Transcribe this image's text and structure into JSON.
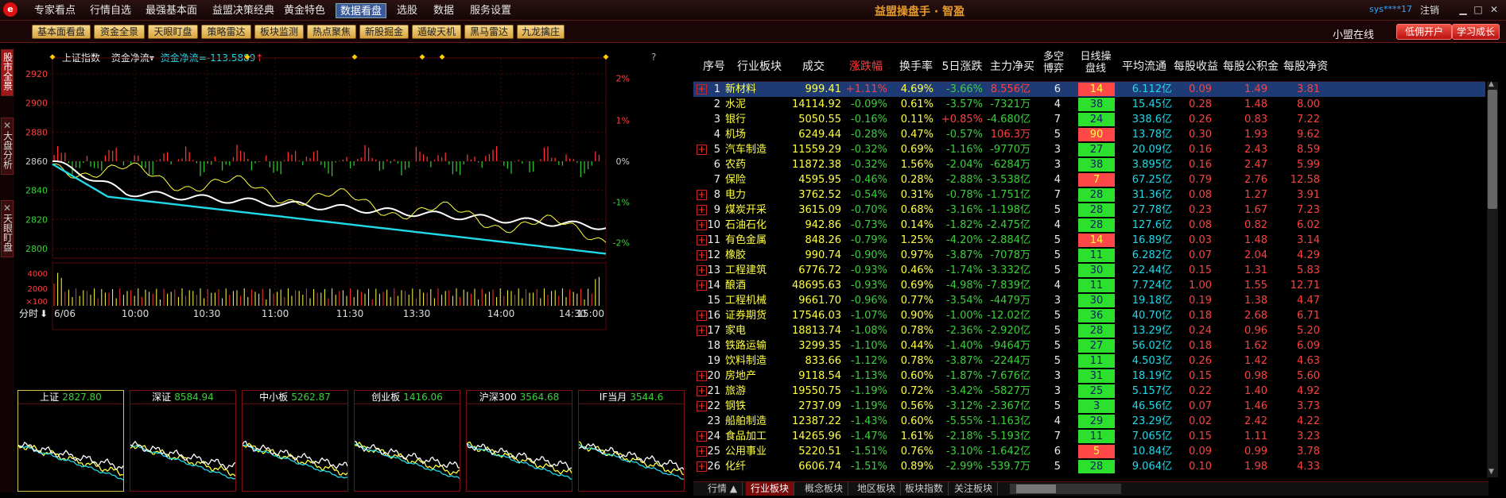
{
  "menu": {
    "logo": "e",
    "items": [
      "专家看点",
      "行情自选",
      "最强基本面",
      "益盟决策经典",
      "黄金特色",
      "数据看盘",
      "选股",
      "数据",
      "服务设置"
    ],
    "active_index": 5
  },
  "app_title": "益盟操盘手 · 智盈",
  "user": "sys****17",
  "logout": "注销",
  "toolbar": {
    "buttons": [
      "基本面看盘",
      "资金全景",
      "天眼盯盘",
      "策略雷达",
      "板块监测",
      "热点聚焦",
      "新股掘金",
      "遁破天机",
      "黑马雷达",
      "九龙擒庄"
    ],
    "online": "小盟在线",
    "open_account": "低佣开户",
    "learn": "学习成长"
  },
  "side_tabs": [
    "股市全景",
    "大盘分析",
    "天眼盯盘"
  ],
  "chart": {
    "index_name": "上证指数",
    "indicator": "资金净流",
    "indicator_value": "资金净流=-113.5889",
    "help": "?",
    "price_ticks": [
      "2920",
      "2900",
      "2880",
      "2860",
      "2840",
      "2820",
      "2800"
    ],
    "pct_ticks": [
      "2%",
      "1%",
      "0%",
      "-1%",
      "-2%"
    ],
    "vol_ticks": [
      "4000",
      "2000",
      "×100"
    ],
    "time_ticks": [
      "6/06",
      "10:00",
      "10:30",
      "11:00",
      "11:30",
      "13:30",
      "14:00",
      "14:30",
      "15:00"
    ],
    "period_label": "分时",
    "period_arrow": "⬇",
    "colors": {
      "price": "#ffffff",
      "avg": "#ffff40",
      "flow": "#20d8e8",
      "up": "#ff3030",
      "down": "#30c030"
    }
  },
  "thumbs": [
    {
      "name": "上证",
      "value": "2827.80"
    },
    {
      "name": "深证",
      "value": "8584.94"
    },
    {
      "name": "中小板",
      "value": "5262.87"
    },
    {
      "name": "创业板",
      "value": "1416.06"
    },
    {
      "name": "沪深300",
      "value": "3564.68"
    },
    {
      "name": "IF当月",
      "value": "3544.6"
    }
  ],
  "table": {
    "headers": [
      "序号",
      "行业板块",
      "成交",
      "涨跌幅",
      "换手率",
      "5日涨跌",
      "主力净买"
    ],
    "headers2": [
      [
        "多空",
        "博弈"
      ],
      [
        "日线操",
        "盘线"
      ]
    ],
    "headers3": [
      "平均流通",
      "每股收益",
      "每股公积金",
      "每股净资"
    ],
    "rows": [
      {
        "no": "1",
        "name": "新材料",
        "vol": "999.41",
        "chg": "+1.11%",
        "turn": "4.69%",
        "d5": "-3.66%",
        "net": "8.556亿",
        "ls": "6",
        "day": "14",
        "flt": "6.112亿",
        "eps": "0.09",
        "cap": "1.49",
        "nav": "3.81",
        "plus": true,
        "sel": true,
        "badge": "red"
      },
      {
        "no": "2",
        "name": "水泥",
        "vol": "14114.92",
        "chg": "-0.09%",
        "turn": "0.61%",
        "d5": "-3.57%",
        "net": "-7321万",
        "ls": "4",
        "day": "38",
        "flt": "15.45亿",
        "eps": "0.28",
        "cap": "1.48",
        "nav": "8.00",
        "plus": false,
        "badge": "green"
      },
      {
        "no": "3",
        "name": "银行",
        "vol": "5050.55",
        "chg": "-0.16%",
        "turn": "0.11%",
        "d5": "+0.85%",
        "net": "-4.680亿",
        "ls": "7",
        "day": "24",
        "flt": "338.6亿",
        "eps": "0.26",
        "cap": "0.83",
        "nav": "7.22",
        "plus": false,
        "badge": "green"
      },
      {
        "no": "4",
        "name": "机场",
        "vol": "6249.44",
        "chg": "-0.28%",
        "turn": "0.47%",
        "d5": "-0.57%",
        "net": "106.3万",
        "ls": "5",
        "day": "90",
        "flt": "13.78亿",
        "eps": "0.30",
        "cap": "1.93",
        "nav": "9.62",
        "plus": false,
        "badge": "red"
      },
      {
        "no": "5",
        "name": "汽车制造",
        "vol": "11559.29",
        "chg": "-0.32%",
        "turn": "0.69%",
        "d5": "-1.16%",
        "net": "-9770万",
        "ls": "3",
        "day": "27",
        "flt": "20.09亿",
        "eps": "0.16",
        "cap": "2.43",
        "nav": "8.59",
        "plus": true,
        "badge": "green"
      },
      {
        "no": "6",
        "name": "农药",
        "vol": "11872.38",
        "chg": "-0.32%",
        "turn": "1.56%",
        "d5": "-2.04%",
        "net": "-6284万",
        "ls": "3",
        "day": "38",
        "flt": "3.895亿",
        "eps": "0.16",
        "cap": "2.47",
        "nav": "5.99",
        "plus": false,
        "badge": "green"
      },
      {
        "no": "7",
        "name": "保险",
        "vol": "4595.95",
        "chg": "-0.46%",
        "turn": "0.28%",
        "d5": "-2.88%",
        "net": "-3.538亿",
        "ls": "4",
        "day": "7",
        "flt": "67.25亿",
        "eps": "0.79",
        "cap": "2.76",
        "nav": "12.58",
        "plus": false,
        "badge": "red"
      },
      {
        "no": "8",
        "name": "电力",
        "vol": "3762.52",
        "chg": "-0.54%",
        "turn": "0.31%",
        "d5": "-0.78%",
        "net": "-1.751亿",
        "ls": "7",
        "day": "28",
        "flt": "31.36亿",
        "eps": "0.08",
        "cap": "1.27",
        "nav": "3.91",
        "plus": true,
        "badge": "green"
      },
      {
        "no": "9",
        "name": "煤炭开采",
        "vol": "3615.09",
        "chg": "-0.70%",
        "turn": "0.68%",
        "d5": "-3.16%",
        "net": "-1.198亿",
        "ls": "5",
        "day": "28",
        "flt": "27.78亿",
        "eps": "0.23",
        "cap": "1.67",
        "nav": "7.23",
        "plus": true,
        "badge": "green"
      },
      {
        "no": "10",
        "name": "石油石化",
        "vol": "942.86",
        "chg": "-0.73%",
        "turn": "0.14%",
        "d5": "-1.82%",
        "net": "-2.475亿",
        "ls": "4",
        "day": "28",
        "flt": "127.6亿",
        "eps": "0.08",
        "cap": "0.82",
        "nav": "6.02",
        "plus": true,
        "badge": "green"
      },
      {
        "no": "11",
        "name": "有色金属",
        "vol": "848.26",
        "chg": "-0.79%",
        "turn": "1.25%",
        "d5": "-4.20%",
        "net": "-2.884亿",
        "ls": "5",
        "day": "14",
        "flt": "16.89亿",
        "eps": "0.03",
        "cap": "1.48",
        "nav": "3.14",
        "plus": true,
        "badge": "red"
      },
      {
        "no": "12",
        "name": "橡胶",
        "vol": "990.74",
        "chg": "-0.90%",
        "turn": "0.97%",
        "d5": "-3.87%",
        "net": "-7078万",
        "ls": "5",
        "day": "11",
        "flt": "6.282亿",
        "eps": "0.07",
        "cap": "2.04",
        "nav": "4.29",
        "plus": true,
        "badge": "green"
      },
      {
        "no": "13",
        "name": "工程建筑",
        "vol": "6776.72",
        "chg": "-0.93%",
        "turn": "0.46%",
        "d5": "-1.74%",
        "net": "-3.332亿",
        "ls": "5",
        "day": "30",
        "flt": "22.44亿",
        "eps": "0.15",
        "cap": "1.31",
        "nav": "5.83",
        "plus": true,
        "badge": "green"
      },
      {
        "no": "14",
        "name": "酿酒",
        "vol": "48695.63",
        "chg": "-0.93%",
        "turn": "0.69%",
        "d5": "-4.98%",
        "net": "-7.839亿",
        "ls": "4",
        "day": "11",
        "flt": "7.724亿",
        "eps": "1.00",
        "cap": "1.55",
        "nav": "12.71",
        "plus": true,
        "badge": "green"
      },
      {
        "no": "15",
        "name": "工程机械",
        "vol": "9661.70",
        "chg": "-0.96%",
        "turn": "0.77%",
        "d5": "-3.54%",
        "net": "-4479万",
        "ls": "3",
        "day": "30",
        "flt": "19.18亿",
        "eps": "0.19",
        "cap": "1.38",
        "nav": "4.47",
        "plus": false,
        "badge": "green"
      },
      {
        "no": "16",
        "name": "证券期货",
        "vol": "17546.03",
        "chg": "-1.07%",
        "turn": "0.90%",
        "d5": "-1.00%",
        "net": "-12.02亿",
        "ls": "5",
        "day": "36",
        "flt": "40.70亿",
        "eps": "0.18",
        "cap": "2.68",
        "nav": "6.71",
        "plus": true,
        "badge": "green"
      },
      {
        "no": "17",
        "name": "家电",
        "vol": "18813.74",
        "chg": "-1.08%",
        "turn": "0.78%",
        "d5": "-2.36%",
        "net": "-2.920亿",
        "ls": "5",
        "day": "28",
        "flt": "13.29亿",
        "eps": "0.24",
        "cap": "0.96",
        "nav": "5.20",
        "plus": true,
        "badge": "green"
      },
      {
        "no": "18",
        "name": "铁路运输",
        "vol": "3299.35",
        "chg": "-1.10%",
        "turn": "0.44%",
        "d5": "-1.40%",
        "net": "-9464万",
        "ls": "5",
        "day": "27",
        "flt": "56.02亿",
        "eps": "0.18",
        "cap": "1.62",
        "nav": "6.09",
        "plus": false,
        "badge": "green"
      },
      {
        "no": "19",
        "name": "饮料制造",
        "vol": "833.66",
        "chg": "-1.12%",
        "turn": "0.78%",
        "d5": "-3.87%",
        "net": "-2244万",
        "ls": "5",
        "day": "11",
        "flt": "4.503亿",
        "eps": "0.26",
        "cap": "1.42",
        "nav": "4.63",
        "plus": false,
        "badge": "green"
      },
      {
        "no": "20",
        "name": "房地产",
        "vol": "9118.54",
        "chg": "-1.13%",
        "turn": "0.60%",
        "d5": "-1.87%",
        "net": "-7.676亿",
        "ls": "3",
        "day": "31",
        "flt": "18.19亿",
        "eps": "0.15",
        "cap": "0.98",
        "nav": "5.60",
        "plus": true,
        "badge": "green"
      },
      {
        "no": "21",
        "name": "旅游",
        "vol": "19550.75",
        "chg": "-1.19%",
        "turn": "0.72%",
        "d5": "-3.42%",
        "net": "-5827万",
        "ls": "3",
        "day": "25",
        "flt": "5.157亿",
        "eps": "0.22",
        "cap": "1.40",
        "nav": "4.92",
        "plus": true,
        "badge": "green"
      },
      {
        "no": "22",
        "name": "钢铁",
        "vol": "2737.09",
        "chg": "-1.19%",
        "turn": "0.56%",
        "d5": "-3.12%",
        "net": "-2.367亿",
        "ls": "5",
        "day": "3",
        "flt": "46.56亿",
        "eps": "0.07",
        "cap": "1.46",
        "nav": "3.73",
        "plus": true,
        "badge": "green"
      },
      {
        "no": "23",
        "name": "船舶制造",
        "vol": "12387.22",
        "chg": "-1.43%",
        "turn": "0.60%",
        "d5": "-5.55%",
        "net": "-1.163亿",
        "ls": "4",
        "day": "29",
        "flt": "23.29亿",
        "eps": "0.02",
        "cap": "2.42",
        "nav": "4.22",
        "plus": false,
        "badge": "green"
      },
      {
        "no": "24",
        "name": "食品加工",
        "vol": "14265.96",
        "chg": "-1.47%",
        "turn": "1.61%",
        "d5": "-2.18%",
        "net": "-5.193亿",
        "ls": "7",
        "day": "11",
        "flt": "7.065亿",
        "eps": "0.15",
        "cap": "1.11",
        "nav": "3.23",
        "plus": true,
        "badge": "green"
      },
      {
        "no": "25",
        "name": "公用事业",
        "vol": "5220.51",
        "chg": "-1.51%",
        "turn": "0.76%",
        "d5": "-3.10%",
        "net": "-1.642亿",
        "ls": "6",
        "day": "5",
        "flt": "10.84亿",
        "eps": "0.09",
        "cap": "0.99",
        "nav": "3.78",
        "plus": true,
        "badge": "red"
      },
      {
        "no": "26",
        "name": "化纤",
        "vol": "6606.74",
        "chg": "-1.51%",
        "turn": "0.89%",
        "d5": "-2.99%",
        "net": "-539.7万",
        "ls": "5",
        "day": "28",
        "flt": "9.064亿",
        "eps": "0.10",
        "cap": "1.98",
        "nav": "4.33",
        "plus": true,
        "badge": "green"
      }
    ]
  },
  "bottom_tabs": [
    "行情 ▲",
    "行业板块",
    "概念板块",
    "地区板块",
    "板块指数",
    "关注板块"
  ],
  "bottom_active": 1
}
